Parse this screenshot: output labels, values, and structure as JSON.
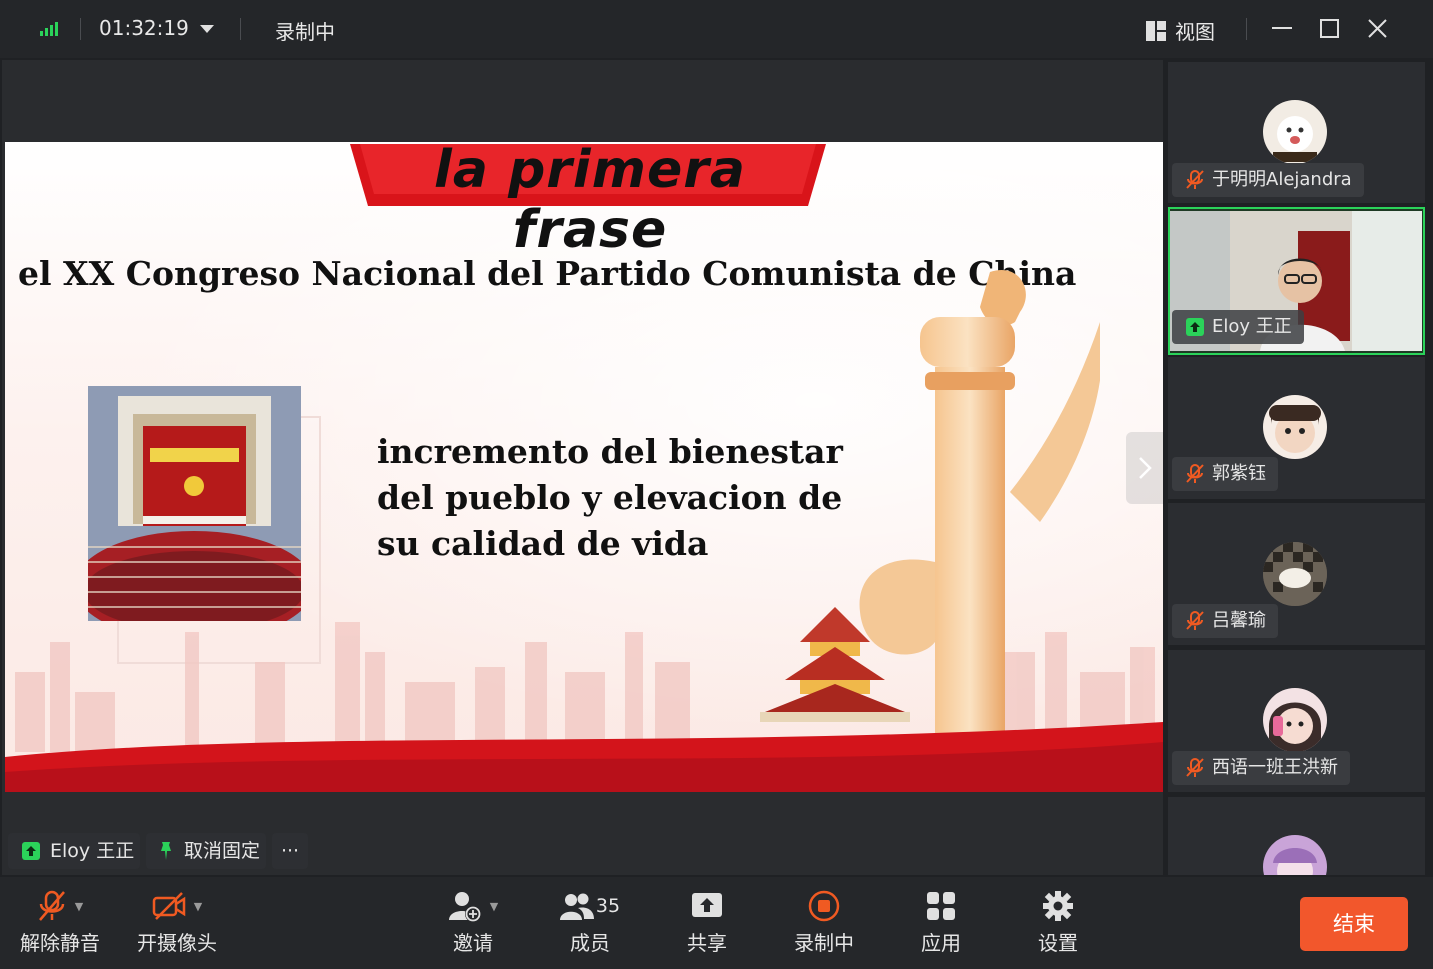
{
  "topbar": {
    "timer": "01:32:19",
    "recording_status": "录制中",
    "view_label": "视图"
  },
  "slide": {
    "banner_title": "la primera frase",
    "heading": "el XX Congreso Nacional del Partido Comunista de China",
    "body_lines": [
      "incremento del bienestar",
      "del pueblo y elevacion de",
      "su calidad de vida"
    ]
  },
  "pinned": {
    "speaker_name": "Eloy 王正",
    "unpin_label": "取消固定",
    "more_label": "···"
  },
  "toolbar": {
    "unmute_label": "解除静音",
    "camera_label": "开摄像头",
    "invite_label": "邀请",
    "members_label": "成员",
    "members_count": "35",
    "share_label": "共享",
    "record_label": "录制中",
    "apps_label": "应用",
    "settings_label": "设置",
    "end_label": "结束"
  },
  "participants": [
    {
      "name": "于明明Alejandra",
      "muted": true
    },
    {
      "name": "Eloy 王正",
      "muted": false,
      "speaking": true
    },
    {
      "name": "郭紫钰",
      "muted": true
    },
    {
      "name": "吕馨瑜",
      "muted": true
    },
    {
      "name": "西语一班王洪新",
      "muted": true
    }
  ],
  "colors": {
    "accent_green": "#2bd35a",
    "end_button": "#f2572c",
    "record_orange": "#f05a22",
    "banner_red": "#d9141a"
  }
}
